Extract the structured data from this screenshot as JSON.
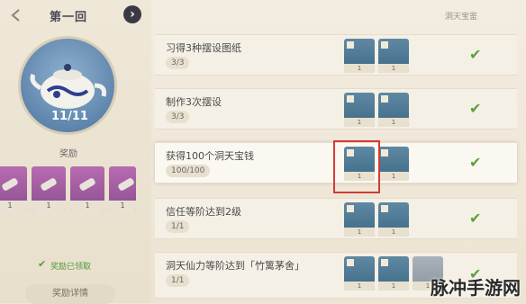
{
  "left": {
    "round_title": "第一回",
    "progress": "11/11",
    "reward_label": "奖励",
    "received_text": "奖励已领取",
    "detail_button": "奖励详情",
    "rewards": [
      {
        "qty": "1"
      },
      {
        "qty": "1"
      },
      {
        "qty": "1"
      },
      {
        "qty": "1"
      }
    ]
  },
  "header": {
    "title": "洞天宝鉴"
  },
  "tasks": [
    {
      "name": "习得3种摆设图纸",
      "progress": "3/3",
      "items": [
        {
          "count": "1"
        },
        {
          "count": "1"
        }
      ]
    },
    {
      "name": "制作3次摆设",
      "progress": "3/3",
      "items": [
        {
          "count": "1"
        },
        {
          "count": "1"
        }
      ]
    },
    {
      "name": "获得100个洞天宝钱",
      "progress": "100/100",
      "items": [
        {
          "count": "1"
        },
        {
          "count": "1"
        }
      ]
    },
    {
      "name": "信任等阶达到2级",
      "progress": "1/1",
      "items": [
        {
          "count": "1"
        },
        {
          "count": "1"
        }
      ]
    },
    {
      "name": "洞天仙力等阶达到「竹篱茅舍」",
      "progress": "1/1",
      "items": [
        {
          "count": "1"
        },
        {
          "count": "1"
        },
        {
          "count": "1"
        }
      ]
    }
  ],
  "watermark": "脉冲手游网",
  "colors": {
    "check": "#5ba13d",
    "highlight": "#d43a33",
    "reward_bg": "#8b4f91"
  }
}
